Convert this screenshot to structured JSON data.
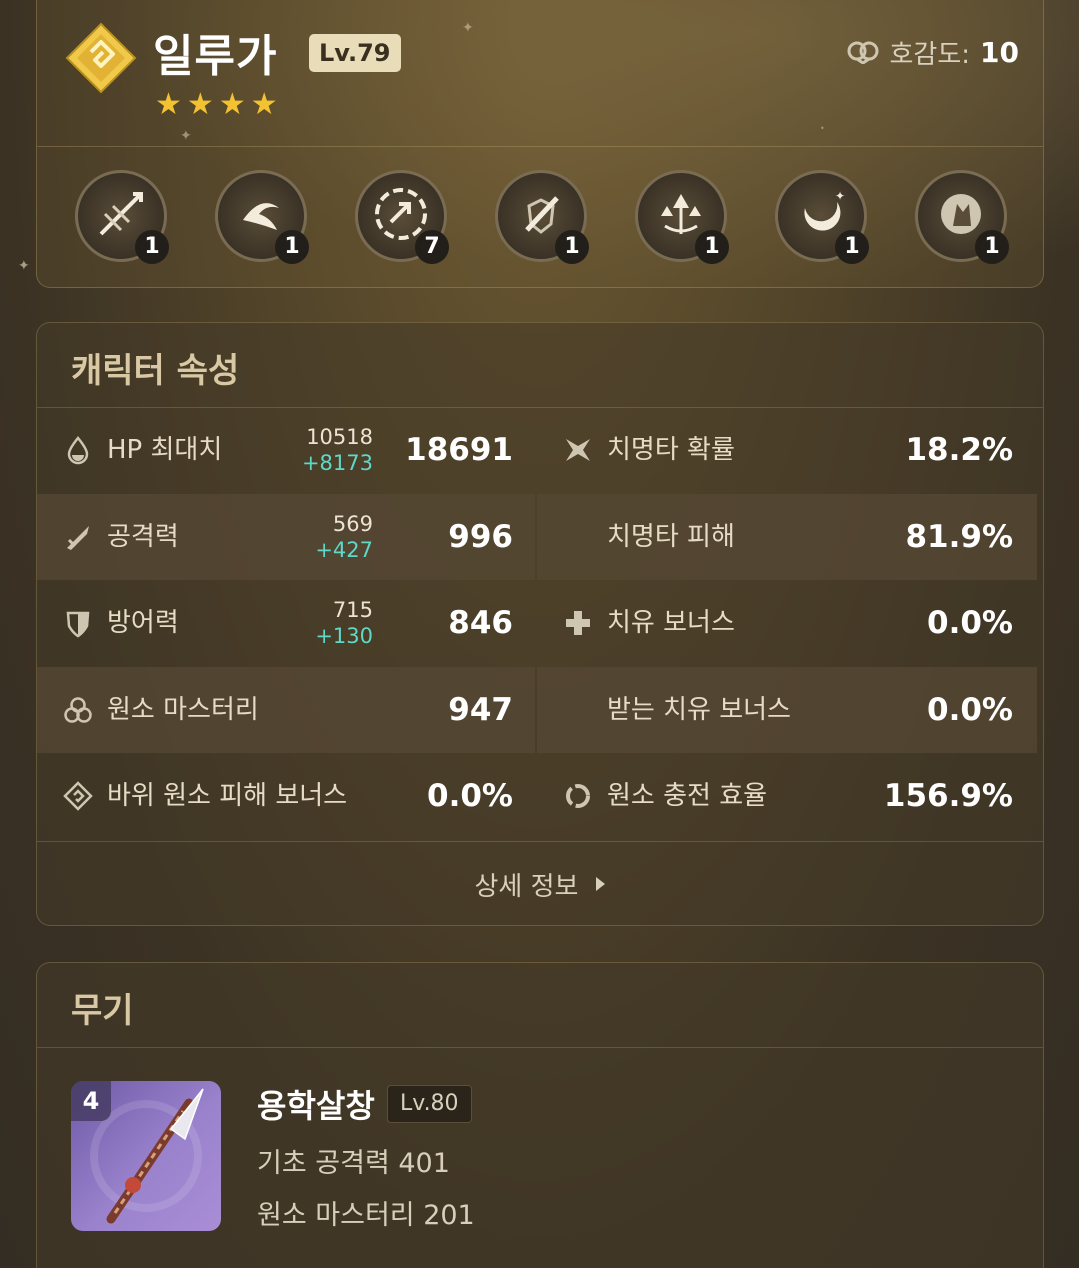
{
  "character": {
    "name": "일루가",
    "level": "Lv.79",
    "rarity": 4,
    "element_icon": "geo-element-icon",
    "friendship_label": "호감도:",
    "friendship_value": "10"
  },
  "talents": [
    {
      "icon": "spear-burst-icon",
      "count": "1"
    },
    {
      "icon": "swirl-wind-icon",
      "count": "1"
    },
    {
      "icon": "circle-rune-icon",
      "count": "7"
    },
    {
      "icon": "shield-sword-icon",
      "count": "1"
    },
    {
      "icon": "triple-arrow-icon",
      "count": "1"
    },
    {
      "icon": "crescent-moon-icon",
      "count": "1"
    },
    {
      "icon": "fox-moon-icon",
      "count": "1"
    }
  ],
  "stats": {
    "title": "캐릭터 속성",
    "rows": [
      {
        "left": {
          "icon": "hp-drop-icon",
          "label": "HP 최대치",
          "base": "10518",
          "add": "+8173",
          "value": "18691"
        },
        "right": {
          "icon": "crit-rate-icon",
          "label": "치명타 확률",
          "value": "18.2%"
        }
      },
      {
        "left": {
          "icon": "atk-sword-icon",
          "label": "공격력",
          "base": "569",
          "add": "+427",
          "value": "996"
        },
        "right": {
          "icon": "",
          "label": "치명타 피해",
          "value": "81.9%"
        }
      },
      {
        "left": {
          "icon": "def-shield-icon",
          "label": "방어력",
          "base": "715",
          "add": "+130",
          "value": "846"
        },
        "right": {
          "icon": "healing-cross-icon",
          "label": "치유 보너스",
          "value": "0.0%"
        }
      },
      {
        "left": {
          "icon": "elemental-mastery-icon",
          "label": "원소 마스터리",
          "base": "",
          "add": "",
          "value": "947"
        },
        "right": {
          "icon": "",
          "label": "받는 치유 보너스",
          "value": "0.0%"
        }
      },
      {
        "left": {
          "icon": "geo-dmg-icon",
          "label": "바위 원소 피해 보너스",
          "base": "",
          "add": "",
          "value": "0.0%"
        },
        "right": {
          "icon": "energy-recharge-icon",
          "label": "원소 충전 효율",
          "value": "156.9%"
        }
      }
    ],
    "detail_link": "상세 정보"
  },
  "weapon": {
    "title": "무기",
    "refinement": "4",
    "name": "용학살창",
    "level": "Lv.80",
    "base_atk": "기초 공격력 401",
    "substat": "원소 마스터리 201"
  },
  "colors": {
    "accent_star": "#f2c232",
    "bonus_stat": "#5fd8c8",
    "level_badge": "#e9dcb8",
    "weapon_bg": "#9a82cc"
  }
}
